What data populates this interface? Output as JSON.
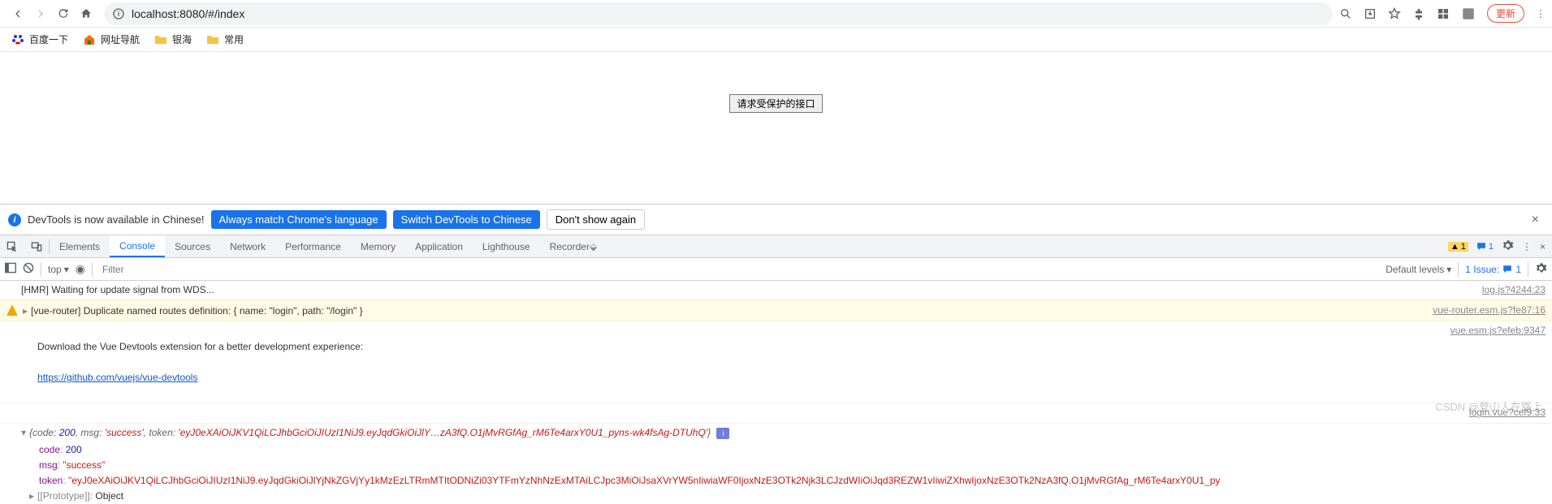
{
  "browser": {
    "url": "localhost:8080/#/index",
    "bookmarks": [
      {
        "label": "百度一下",
        "icon": "baidu"
      },
      {
        "label": "网址导航",
        "icon": "nav2345"
      },
      {
        "label": "银海",
        "icon": "folder"
      },
      {
        "label": "常用",
        "icon": "folder"
      }
    ],
    "menu_label": "更新"
  },
  "page": {
    "button_label": "请求受保护的接口"
  },
  "infobar": {
    "text": "DevTools is now available in Chinese!",
    "btn_always": "Always match Chrome's language",
    "btn_switch": "Switch DevTools to Chinese",
    "btn_dont": "Don't show again"
  },
  "devtools": {
    "tabs": [
      "Elements",
      "Console",
      "Sources",
      "Network",
      "Performance",
      "Memory",
      "Application",
      "Lighthouse",
      "Recorder"
    ],
    "active_tab": "Console",
    "warn_count": "1",
    "chat_count": "1",
    "filter_placeholder": "Filter",
    "context": "top",
    "levels": "Default levels",
    "issue_label": "1 Issue:",
    "issue_count": "1"
  },
  "logs": {
    "hmr": "[HMR] Waiting for update signal from WDS...",
    "hmr_src": "log.js?4244:23",
    "router_warn": "[vue-router] Duplicate named routes definition: { name: \"login\", path: \"/login\" }",
    "router_src": "vue-router.esm.js?fe87:16",
    "vuedev_text": "Download the Vue Devtools extension for a better development experience:",
    "vuedev_link": "https://github.com/vuejs/vue-devtools",
    "vuedev_src": "vue.esm.js?efeb:9347",
    "login_src": "login.vue?cef9:33",
    "obj_summary_code": "200",
    "obj_summary_msg": "'success'",
    "obj_summary_token": "'eyJ0eXAiOiJKV1QiLCJhbGciOiJIUzI1NiJ9.eyJqdGkiOiJlY…zA3fQ.O1jMvRGfAg_rM6Te4arxY0U1_pyns-wk4fsAg-DTUhQ'",
    "obj_code_k": "code",
    "obj_code_v": "200",
    "obj_msg_k": "msg",
    "obj_msg_v": "\"success\"",
    "obj_token_k": "token",
    "obj_token_v": "\"eyJ0eXAiOiJKV1QiLCJhbGciOiJIUzI1NiJ9.eyJqdGkiOiJlYjNkZGVjYy1kMzEzLTRmMTItODNiZi03YTFmYzNhNzExMTAiLCJpc3MiOiJsaXVrYW5nIiwiaWF0IjoxNzE3OTk2Njk3LCJzdWIiOiJqd3REZW1vIiwiZXhwIjoxNzE3OTk2NzA3fQ.O1jMvRGfAg_rM6Te4arxY0U1_py",
    "obj_proto": "[[Prototype]]",
    "obj_proto_v": "Object"
  },
  "watermark": "CSDN @登山人在路上"
}
